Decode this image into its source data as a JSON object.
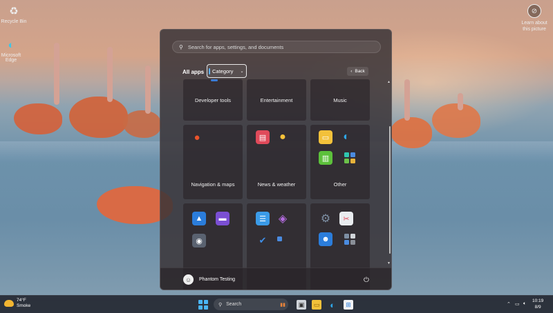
{
  "desktop": {
    "recycle_bin_label": "Recycle Bin",
    "edge_label": "Microsoft Edge",
    "learn_label": "Learn about this picture"
  },
  "start_menu": {
    "search_placeholder": "Search for apps, settings, and documents",
    "all_apps_label": "All apps",
    "view_dropdown_value": "Category",
    "back_label": "Back",
    "categories": [
      {
        "name": "Developer tools"
      },
      {
        "name": "Entertainment"
      },
      {
        "name": "Music"
      },
      {
        "name": "Navigation & maps"
      },
      {
        "name": "News & weather"
      },
      {
        "name": "Other"
      }
    ],
    "user_name": "Phantom Testing"
  },
  "taskbar": {
    "weather_temp": "74°F",
    "weather_condition": "Smoke",
    "search_label": "Search",
    "time": "10:19",
    "date": "8/9"
  },
  "colors": {
    "accent": "#4ab5f5",
    "menu_bg": "#3a3438",
    "taskbar_bg": "#222630"
  }
}
